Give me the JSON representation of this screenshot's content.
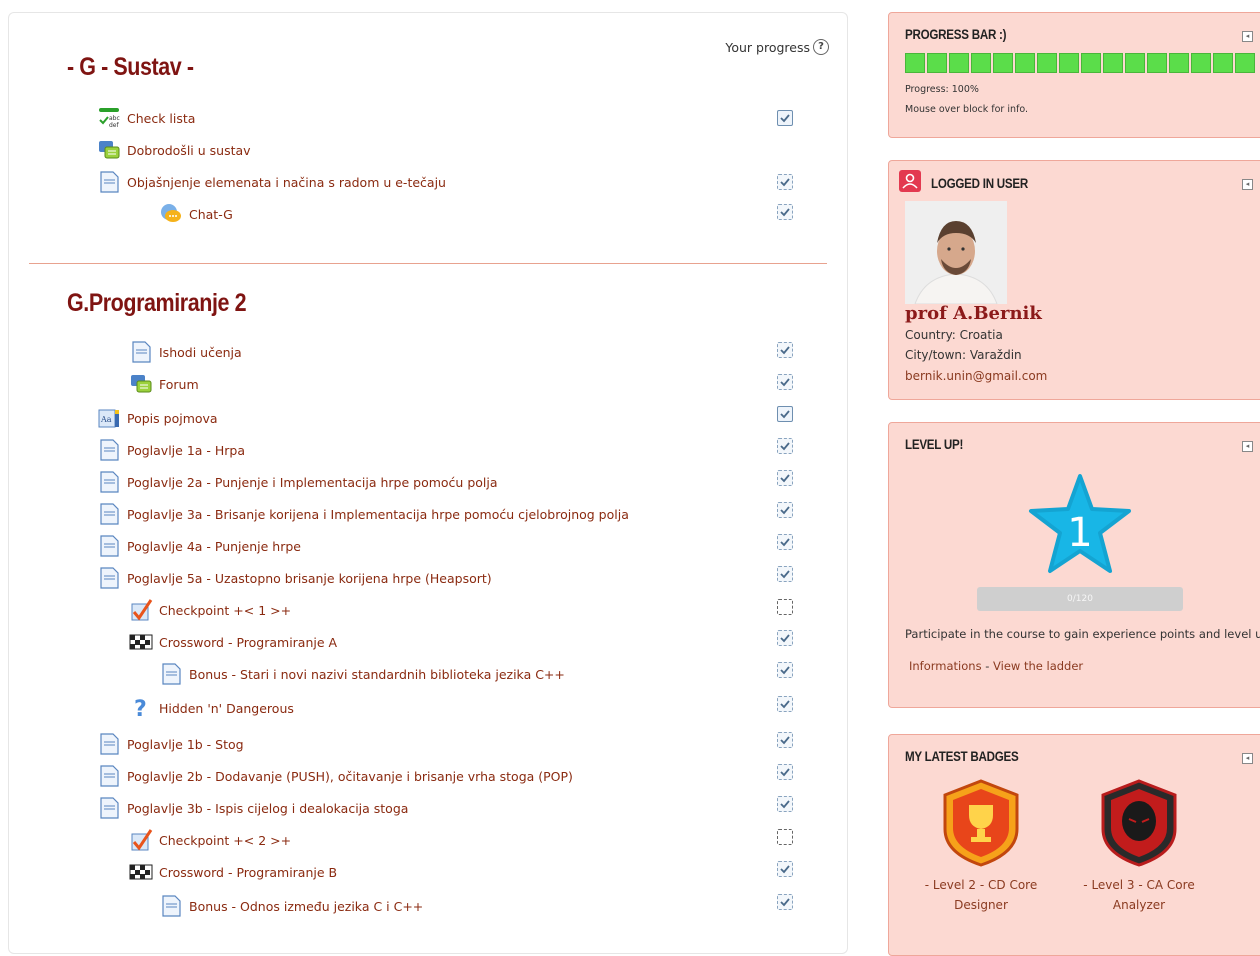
{
  "main": {
    "progress_caption": "Your progress",
    "sections": [
      {
        "title": "- G - Sustav -",
        "items": [
          {
            "label": "Check lista",
            "icon": "checklist-icon",
            "status": "solid"
          },
          {
            "label": "Dobrodošli u sustav",
            "icon": "forum-icon",
            "status": "none"
          },
          {
            "label": "Objašnjenje elemenata i načina s radom u e-tečaju",
            "icon": "page-icon",
            "status": "dash"
          },
          {
            "label": "Chat-G",
            "icon": "chat-icon",
            "status": "dash"
          }
        ]
      },
      {
        "title": "G.Programiranje 2",
        "items": [
          {
            "label": "Ishodi učenja",
            "icon": "page-icon",
            "status": "dash"
          },
          {
            "label": "Forum",
            "icon": "forum-icon",
            "status": "dash"
          },
          {
            "label": "Popis pojmova",
            "icon": "glossary-icon",
            "status": "solid"
          },
          {
            "label": "Poglavlje 1a - Hrpa",
            "icon": "page-icon",
            "status": "dash"
          },
          {
            "label": "Poglavlje 2a - Punjenje i Implementacija hrpe pomoću polja",
            "icon": "page-icon",
            "status": "dash"
          },
          {
            "label": "Poglavlje 3a - Brisanje korijena i Implementacija hrpe pomoću cjelobrojnog polja",
            "icon": "page-icon",
            "status": "dash"
          },
          {
            "label": "Poglavlje 4a - Punjenje hrpe",
            "icon": "page-icon",
            "status": "dash"
          },
          {
            "label": "Poglavlje 5a - Uzastopno brisanje korijena hrpe (Heapsort)",
            "icon": "page-icon",
            "status": "dash"
          },
          {
            "label": "Checkpoint +< 1 >+",
            "icon": "checkpoint-icon",
            "status": "empty"
          },
          {
            "label": "Crossword - Programiranje A",
            "icon": "crossword-icon",
            "status": "dash"
          },
          {
            "label": "Bonus - Stari i novi nazivi standardnih biblioteka jezika C++",
            "icon": "page-icon",
            "status": "dash"
          },
          {
            "label": "Hidden 'n' Dangerous",
            "icon": "question-icon",
            "status": "dash"
          },
          {
            "label": "Poglavlje 1b - Stog",
            "icon": "page-icon",
            "status": "dash"
          },
          {
            "label": "Poglavlje 2b - Dodavanje (PUSH), očitavanje i brisanje vrha stoga (POP)",
            "icon": "page-icon",
            "status": "dash"
          },
          {
            "label": "Poglavlje 3b - Ispis cijelog i dealokacija stoga",
            "icon": "page-icon",
            "status": "dash"
          },
          {
            "label": "Checkpoint +< 2 >+",
            "icon": "checkpoint-icon",
            "status": "empty"
          },
          {
            "label": "Crossword - Programiranje B",
            "icon": "crossword-icon",
            "status": "dash"
          },
          {
            "label": "Bonus - Odnos između jezika C i C++",
            "icon": "page-icon",
            "status": "dash"
          }
        ]
      }
    ]
  },
  "progress_block": {
    "title": "PROGRESS BAR :)",
    "progress_text": "Progress: 100%",
    "hint": "Mouse over block for info.",
    "segments": 16,
    "fraction": 1.0
  },
  "user_block": {
    "title": "LOGGED IN USER",
    "name": "prof A.Bernik",
    "country": "Country: Croatia",
    "city": "City/town: Varaždin",
    "email": "bernik.unin@gmail.com"
  },
  "level_block": {
    "title": "LEVEL UP!",
    "level": "1",
    "xp": "0/120",
    "xp_fraction": 0,
    "message": "Participate in the course to gain experience points and level up!",
    "link_info": "Informations",
    "separator": "-",
    "link_ladder": "View the ladder"
  },
  "badges_block": {
    "title": "MY LATEST BADGES",
    "badges": [
      {
        "label": "- Level 2 - CD Core Designer",
        "icon": "trophy-badge-icon"
      },
      {
        "label": "- Level 3 - CA Core Analyzer",
        "icon": "skull-badge-icon"
      }
    ]
  },
  "colors": {
    "section_title": "#7f1412",
    "link": "#8a2a10",
    "block_bg": "#fcd9d2",
    "block_border": "#efa79a",
    "progress_green": "#5bdd4a",
    "star": "#18b6e6"
  }
}
